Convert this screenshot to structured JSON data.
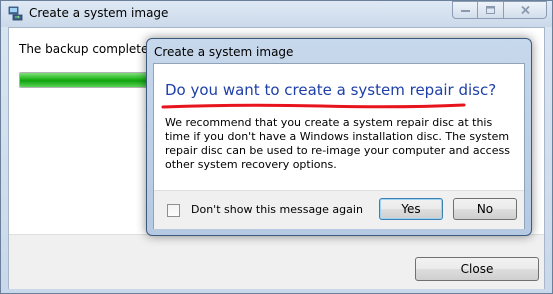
{
  "main_window": {
    "title": "Create a system image",
    "status_text": "The backup completed s",
    "progress": 1.0,
    "close_label": "Close"
  },
  "dialog": {
    "title": "Create a system image",
    "heading": "Do you want to create a system repair disc?",
    "body": "We recommend that you create a system repair disc at this time if you don't have a Windows installation disc. The system repair disc can be used to re-image your computer and access other system recovery options.",
    "checkbox_label": "Don't show this message again",
    "checkbox_checked": false,
    "yes_label": "Yes",
    "no_label": "No"
  },
  "colors": {
    "heading": "#1e3fa8",
    "annotation_underline": "#e8141d",
    "progress_fill": "#1fb51a"
  }
}
